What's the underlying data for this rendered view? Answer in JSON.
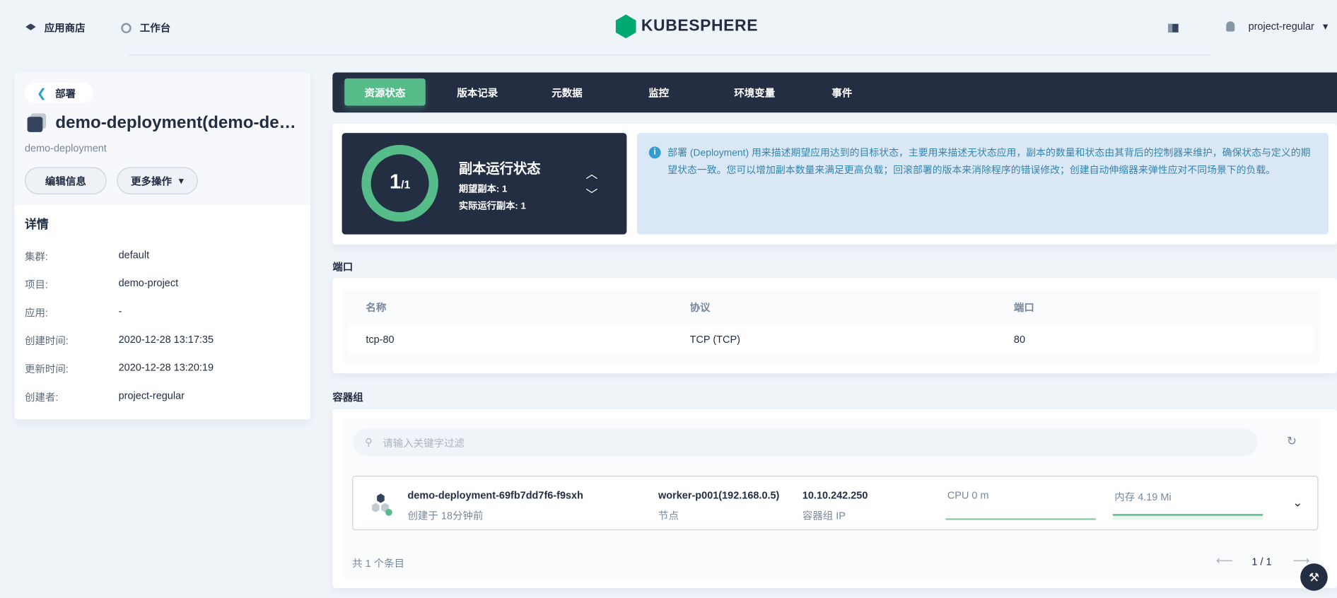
{
  "header": {
    "app_store": "应用商店",
    "workbench": "工作台",
    "logo": "KUBESPHERE",
    "user": "project-regular"
  },
  "sidebar": {
    "back": "部署",
    "title": "demo-deployment(demo-depl...",
    "subtitle": "demo-deployment",
    "edit": "编辑信息",
    "more": "更多操作",
    "details_title": "详情",
    "details": [
      {
        "k": "集群:",
        "v": "default"
      },
      {
        "k": "项目:",
        "v": "demo-project"
      },
      {
        "k": "应用:",
        "v": "-"
      },
      {
        "k": "创建时间:",
        "v": "2020-12-28 13:17:35"
      },
      {
        "k": "更新时间:",
        "v": "2020-12-28 13:20:19"
      },
      {
        "k": "创建者:",
        "v": "project-regular"
      }
    ]
  },
  "tabs": [
    "资源状态",
    "版本记录",
    "元数据",
    "监控",
    "环境变量",
    "事件"
  ],
  "replica": {
    "current": "1",
    "total": "/1",
    "title": "副本运行状态",
    "desired": "期望副本: 1",
    "actual": "实际运行副本: 1",
    "ratio": 1.0
  },
  "info": "部署 (Deployment) 用来描述期望应用达到的目标状态，主要用来描述无状态应用，副本的数量和状态由其背后的控制器来维护，确保状态与定义的期望状态一致。您可以增加副本数量来满足更高负载；回滚部署的版本来消除程序的错误修改；创建自动伸缩器来弹性应对不同场景下的负载。",
  "ports": {
    "title": "端口",
    "headers": [
      "名称",
      "协议",
      "端口"
    ],
    "rows": [
      [
        "tcp-80",
        "TCP (TCP)",
        "80"
      ]
    ]
  },
  "pods": {
    "title": "容器组",
    "search_placeholder": "请输入关键字过滤",
    "items": [
      {
        "name": "demo-deployment-69fb7dd7f6-f9sxh",
        "created": "创建于 18分钟前",
        "node": "worker-p001(192.168.0.5)",
        "node_label": "节点",
        "ip": "10.10.242.250",
        "ip_label": "容器组 IP",
        "cpu": "CPU 0 m",
        "mem": "内存 4.19 Mi"
      }
    ],
    "total": "共 1 个条目",
    "page": "1 / 1"
  },
  "colors": {
    "accent": "#55bc8a",
    "dark": "#242e42",
    "info_bg": "#dae8f5"
  }
}
